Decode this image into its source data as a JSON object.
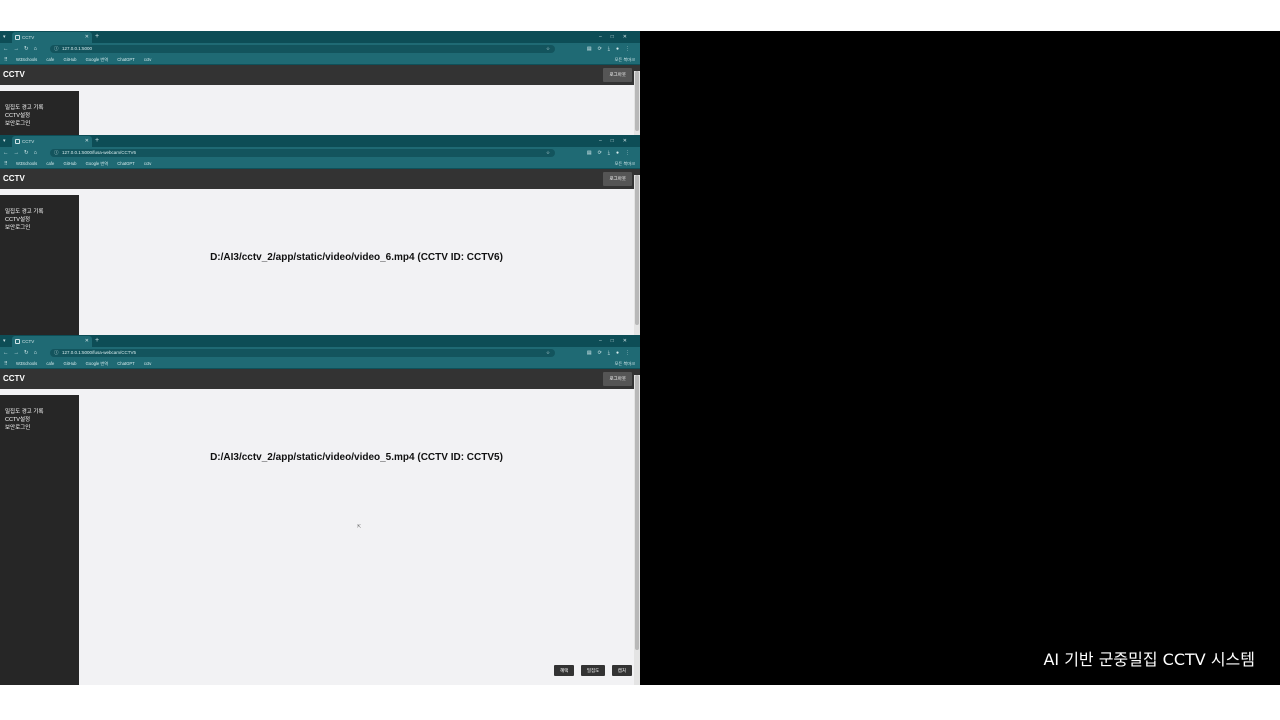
{
  "caption": "AI 기반 군중밀집 CCTV 시스템",
  "colors": {
    "tabbar": "#0d4d56",
    "toolbar": "#1f6a74",
    "header": "#333333",
    "sidebar": "#262626",
    "main": "#f2f2f4"
  },
  "bookmarks": {
    "items": [
      "W3Schools",
      "cafe",
      "GitHub",
      "Google 번역",
      "ChatGPT",
      "cctv"
    ],
    "all": "모든 북마크"
  },
  "header": {
    "brand": "CCTV",
    "logout": "로그아웃"
  },
  "sidebar": {
    "items": [
      "밀집도 경고 기록",
      "CCTV설정",
      "보안로그인"
    ]
  },
  "windows": [
    {
      "tab_title": "CCTV",
      "url": "127.0.0.1:5000",
      "video_label": ""
    },
    {
      "tab_title": "CCTV",
      "url": "127.0.0.1:5000/fusa-webcam/CCTV6",
      "video_label": "D:/AI3/cctv_2/app/static/video/video_6.mp4 (CCTV ID: CCTV6)"
    },
    {
      "tab_title": "CCTV",
      "url": "127.0.0.1:5000/fusa-webcam/CCTV5",
      "video_label": "D:/AI3/cctv_2/app/static/video/video_5.mp4 (CCTV ID: CCTV5)"
    }
  ],
  "buttons": [
    "혜택",
    "밀집도",
    "캡처"
  ]
}
